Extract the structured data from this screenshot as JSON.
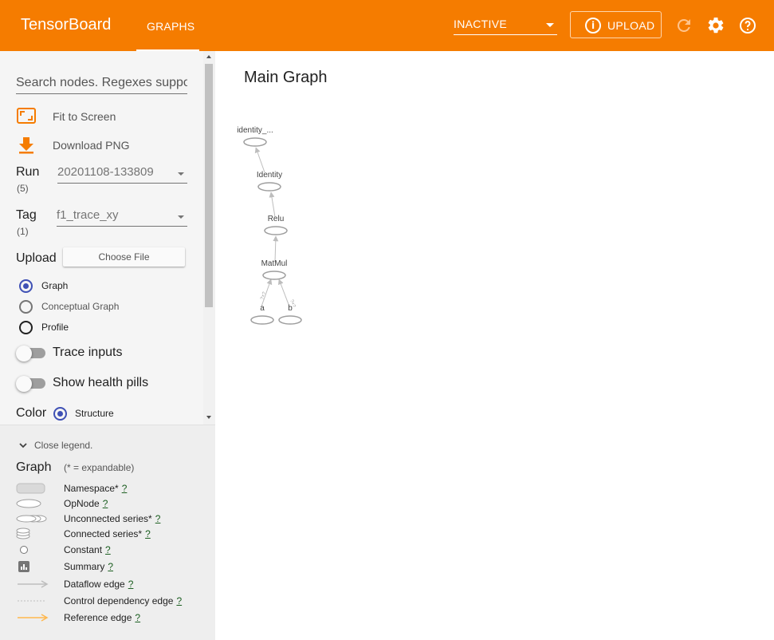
{
  "header": {
    "brand": "TensorBoard",
    "tab": "GRAPHS",
    "run_selector": "INACTIVE",
    "upload_label": "UPLOAD",
    "info_glyph": "i"
  },
  "controls": {
    "search_placeholder": "Search nodes. Regexes supported.",
    "fit_to_screen": "Fit to Screen",
    "download_png": "Download PNG",
    "run_label": "Run",
    "run_count": "(5)",
    "run_value": "20201108-133809",
    "tag_label": "Tag",
    "tag_count": "(1)",
    "tag_value": "f1_trace_xy",
    "upload_label": "Upload",
    "choose_file": "Choose File",
    "graph_types": [
      "Graph",
      "Conceptual Graph",
      "Profile"
    ],
    "trace_inputs": "Trace inputs",
    "show_health_pills": "Show health pills",
    "color_label": "Color",
    "color_option": "Structure"
  },
  "legend": {
    "toggle": "Close legend.",
    "title": "Graph",
    "note": "(* = expandable)",
    "q": "?",
    "items": [
      "Namespace*",
      "OpNode",
      "Unconnected series*",
      "Connected series*",
      "Constant",
      "Summary",
      "Dataflow edge",
      "Control dependency edge",
      "Reference edge"
    ]
  },
  "main": {
    "title": "Main Graph",
    "nodes": [
      "identity_...",
      "Identity",
      "Relu",
      "MatMul",
      "a",
      "b"
    ],
    "edge_labels": [
      "?×?",
      "?×?"
    ]
  },
  "colors": {
    "header": "#f57c00",
    "radio_accent": "#3f51b5",
    "reference_edge": "#ffb74d"
  }
}
